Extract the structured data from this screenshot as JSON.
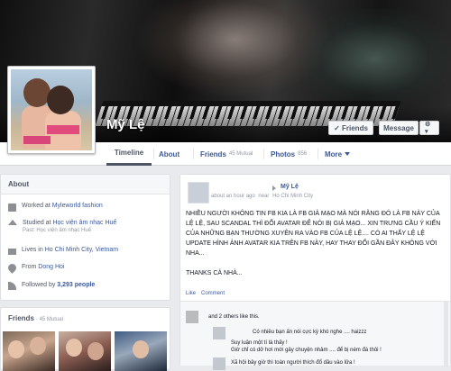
{
  "profile": {
    "name": "Mỹ Lệ",
    "buttons": {
      "friends": "✓ Friends",
      "message": "Message",
      "gear": "⚙ ▾"
    }
  },
  "nav": {
    "tabs": [
      {
        "label": "Timeline",
        "count": ""
      },
      {
        "label": "About",
        "count": ""
      },
      {
        "label": "Friends",
        "count": "45 Mutual"
      },
      {
        "label": "Photos",
        "count": "856"
      },
      {
        "label": "More",
        "count": ""
      }
    ]
  },
  "about": {
    "title": "About",
    "work": {
      "prefix": "Worked at ",
      "link": "Myleworld fashion"
    },
    "study": {
      "prefix": "Studied at ",
      "link": "Học viện âm nhạc Huế",
      "sub": "Past: Học viện âm nhạc Huế"
    },
    "lives": {
      "prefix": "Lives in ",
      "link": "Ho Chi Minh City, Vietnam"
    },
    "from": {
      "prefix": "From ",
      "link": "Dong Hoi"
    },
    "followed": {
      "prefix": "Followed by ",
      "link": "3,293 people"
    }
  },
  "friends_box": {
    "title": "Friends",
    "count": "· 45 Mutual"
  },
  "post": {
    "author": "Mỹ Lệ",
    "time": "about an hour ago",
    "location_prefix": "near",
    "location": "Ho Chi Minh City",
    "body_1": "NHIỀU NGƯỜI KHÔNG TIN FB KIA LÀ FB GIẢ MẠO MÀ NÓI RẰNG ĐÓ LÀ FB NÀY CỦA LỆ LỆ, SAU SCANDAL THÌ ĐỔI AVATAR ĐỂ NÓI BỊ GIẢ MẠO... XIN TRƯNG CẦU Ý KIẾN CỦA NHỮNG BẠN THƯỜNG XUYÊN RA VÀO FB CỦA LỆ LỆ.... CÓ AI THẤY LỆ LỆ UPDATE HÌNH ẢNH AVATAR KIA TRÊN FB NÀY, HAY THAY ĐỔI GẦN ĐÂY KHÔNG VỚI NHA...",
    "body_2": "THANKS CẢ NHÀ...",
    "actions": {
      "like": "Like",
      "dot": "·",
      "comment": "Comment"
    },
    "likes": {
      "link": "",
      "text": "and 2 others like this."
    },
    "comments": [
      "Có nhiều bạn ấn nói cực kỳ khó nghe .... haizzz",
      "Suy luận một tí là thấy !",
      "Giờ chỉ có dở hơi mới gây chuyện nhảm .... để bị ném đá thôi !",
      "Xã hội bây giờ thì toàn người thích đổ dầu vào lửa !"
    ]
  }
}
